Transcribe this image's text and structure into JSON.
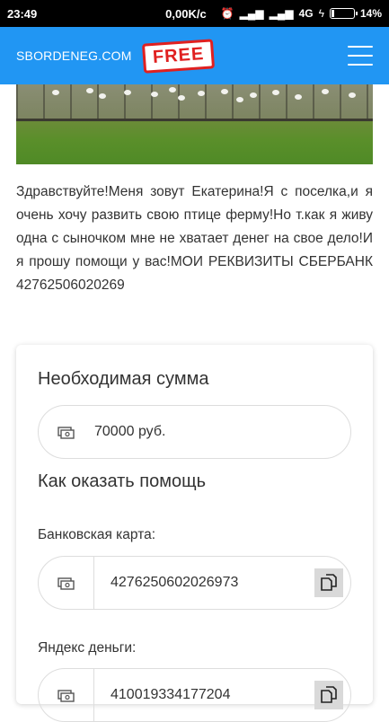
{
  "status_bar": {
    "time": "23:49",
    "network_speed": "0,00K/c",
    "network_type": "4G",
    "battery": "14%",
    "battery_level": 0.14
  },
  "header": {
    "brand": "SBORDENEG.COM",
    "badge": "FREE",
    "background_color": "#2196f3"
  },
  "story": {
    "text": "Здравствуйте!Меня зовут Екатерина!Я с поселка,и я очень хочу развить свою птице ферму!Но т.как я живу одна с сыночком мне не хватает денег на свое дело!И я прошу помощи у вас!МОИ РЕКВИЗИТЫ СБЕРБАНК 42762506020269"
  },
  "card": {
    "required_amount_heading": "Необходимая сумма",
    "amount_value": "70000 руб.",
    "how_to_help_heading": "Как оказать помощь",
    "bank_card_label": "Банковская карта:",
    "bank_card_value": "4276250602026973",
    "yandex_label": "Яндекс деньги:",
    "yandex_value": "410019334177204"
  },
  "icons": {
    "money": "money-icon",
    "copy": "copy-icon",
    "menu": "hamburger-menu-icon"
  }
}
